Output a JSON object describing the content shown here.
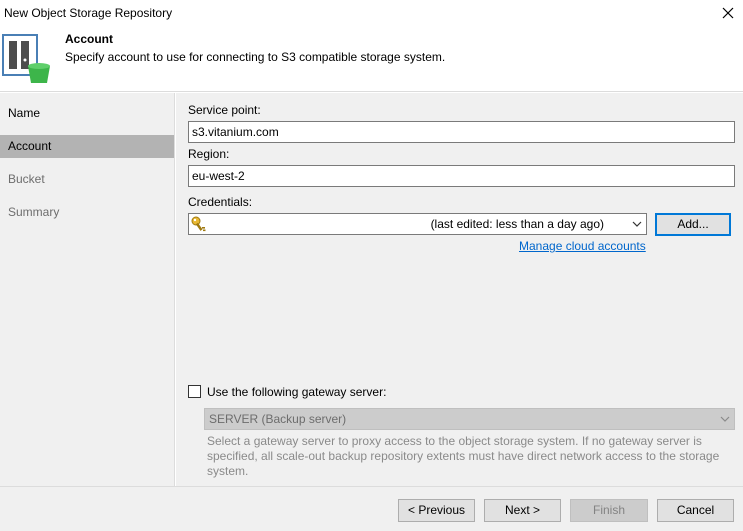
{
  "window": {
    "title": "New Object Storage Repository"
  },
  "header": {
    "title": "Account",
    "description": "Specify account to use for connecting to S3 compatible storage system."
  },
  "sidebar": {
    "items": [
      {
        "label": "Name"
      },
      {
        "label": "Account"
      },
      {
        "label": "Bucket"
      },
      {
        "label": "Summary"
      }
    ]
  },
  "form": {
    "service_point": {
      "label": "Service point:",
      "value": "s3.vitanium.com"
    },
    "region": {
      "label": "Region:",
      "value": "eu-west-2"
    },
    "credentials": {
      "label": "Credentials:",
      "value": "(last edited: less than a day ago)"
    },
    "add_button": "Add...",
    "manage_link": "Manage cloud accounts",
    "gateway": {
      "checkbox_label": "Use the following gateway server:",
      "checked": false,
      "server_value": "SERVER (Backup server)",
      "hint": "Select a gateway server to proxy access to the object storage system. If no gateway server is specified, all scale-out backup repository extents must have direct network access to the storage system."
    }
  },
  "footer": {
    "previous": "< Previous",
    "next": "Next >",
    "finish": "Finish",
    "cancel": "Cancel"
  },
  "icons": {
    "close": "close-icon",
    "wizard": "object-storage-icon",
    "key": "key-icon",
    "dropdown": "chevron-down-icon"
  },
  "colors": {
    "link": "#0066cc",
    "selected_nav": "#b3b3b3",
    "panel": "#f0f0f0",
    "focus": "#0078d7",
    "icon_green": "#3db54a"
  }
}
